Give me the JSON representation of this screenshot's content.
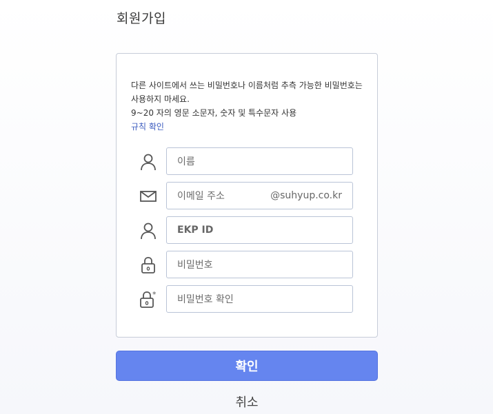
{
  "page": {
    "title": "회원가입"
  },
  "notice": {
    "line1": "다른 사이트에서 쓰는 비밀번호나 이름처럼 추측 가능한 비밀번호는 사용하지 마세요.",
    "line2": "9~20 자의 영문 소문자, 숫자 및 특수문자 사용",
    "rule_link": "규칙 확인"
  },
  "fields": {
    "name": {
      "placeholder": "이름",
      "icon": "user-icon"
    },
    "email": {
      "placeholder": "이메일 주소",
      "suffix": "@suhyup.co.kr",
      "icon": "mail-icon"
    },
    "ekp_id": {
      "placeholder": "EKP ID",
      "icon": "user-icon"
    },
    "password": {
      "placeholder": "비밀번호",
      "icon": "lock-icon"
    },
    "password_confirm": {
      "placeholder": "비밀번호 확인",
      "icon": "lock-asterisk-icon"
    }
  },
  "actions": {
    "confirm": "확인",
    "cancel": "취소"
  },
  "colors": {
    "accent": "#6585ef",
    "link": "#3b5bbf",
    "border": "#b9c3d6"
  }
}
